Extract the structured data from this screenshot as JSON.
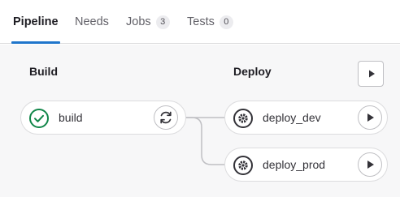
{
  "tabs": [
    {
      "label": "Pipeline",
      "active": true
    },
    {
      "label": "Needs"
    },
    {
      "label": "Jobs",
      "count": "3"
    },
    {
      "label": "Tests",
      "count": "0"
    }
  ],
  "stages": [
    {
      "title": "Build",
      "jobs": [
        {
          "name": "build",
          "status": "success",
          "status_icon": "check-circle-icon",
          "action_icon": "retry-icon"
        }
      ]
    },
    {
      "title": "Deploy",
      "stage_action_icon": "play-icon",
      "jobs": [
        {
          "name": "deploy_dev",
          "status": "manual",
          "status_icon": "gear-icon",
          "action_icon": "play-icon"
        },
        {
          "name": "deploy_prod",
          "status": "manual",
          "status_icon": "gear-icon",
          "action_icon": "play-icon"
        }
      ]
    }
  ],
  "colors": {
    "accent": "#1f75cb",
    "success": "#108548",
    "manual": "#333238",
    "link": "#bfbfc3"
  }
}
